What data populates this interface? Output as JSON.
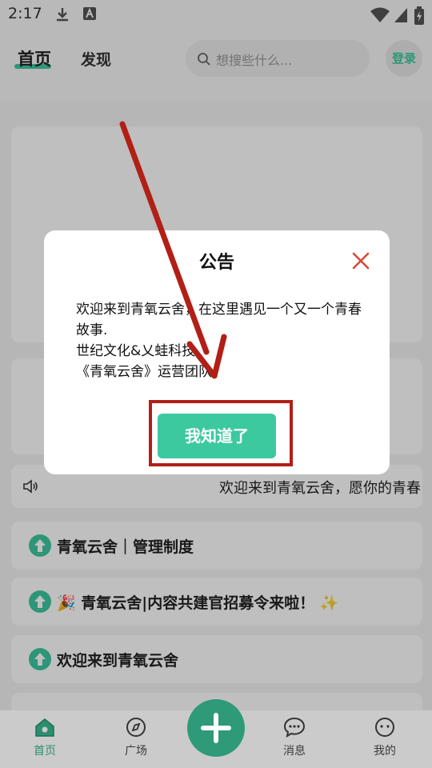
{
  "status_bar": {
    "time": "2:17"
  },
  "header": {
    "tab_home": "首页",
    "tab_discover": "发现",
    "search_placeholder": "想搜些什么...",
    "login": "登录"
  },
  "marquee": {
    "text": "欢迎来到青氧云舍，愿你的青春"
  },
  "posts": [
    {
      "title": "青氧云舍｜管理制度",
      "emoji_before": "",
      "emoji_after": ""
    },
    {
      "title": "青氧云舍|内容共建官招募令来啦！",
      "emoji_before": "🎉",
      "emoji_after": "✨"
    },
    {
      "title": "欢迎来到青氧云舍",
      "emoji_before": "",
      "emoji_after": ""
    }
  ],
  "tabbar": {
    "home": "首页",
    "square": "广场",
    "messages": "消息",
    "mine": "我的"
  },
  "dialog": {
    "title": "公告",
    "line1": "欢迎来到青氧云舍，在这里遇见一个又一个青春故事.",
    "line2": "世纪文化&乂蛙科技",
    "line3": "《青氧云舍》运营团队",
    "ok_label": "我知道了"
  },
  "colors": {
    "accent": "#3cc9a0",
    "fab": "#2e9a78",
    "annotation": "#b11f17"
  }
}
